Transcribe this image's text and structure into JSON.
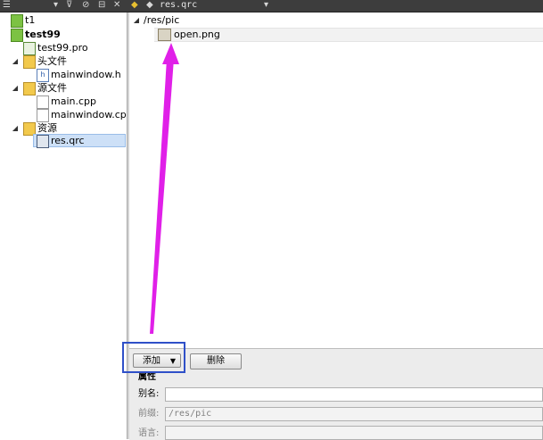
{
  "toolbar": {
    "file_tab": "res.qrc"
  },
  "project_tree": {
    "items": [
      {
        "label": "t1",
        "bold": false
      },
      {
        "label": "test99",
        "bold": true
      },
      {
        "label": "test99.pro",
        "bold": false
      },
      {
        "label": "头文件",
        "bold": false
      },
      {
        "label": "mainwindow.h",
        "bold": false
      },
      {
        "label": "源文件",
        "bold": false
      },
      {
        "label": "main.cpp",
        "bold": false
      },
      {
        "label": "mainwindow.cpp",
        "bold": false
      },
      {
        "label": "资源",
        "bold": false
      },
      {
        "label": "res.qrc",
        "bold": false,
        "selected": true
      }
    ]
  },
  "resource_tree": {
    "prefix": "/res/pic",
    "files": [
      "open.png"
    ]
  },
  "buttons": {
    "add": "添加",
    "delete": "删除"
  },
  "properties": {
    "title": "属性",
    "alias_label": "别名:",
    "alias_value": "",
    "prefix_label": "前缀:",
    "prefix_value": "/res/pic",
    "language_label": "语言:",
    "language_value": ""
  },
  "colors": {
    "annotation_arrow": "#e020e8",
    "highlight_box": "#2f50c8"
  }
}
